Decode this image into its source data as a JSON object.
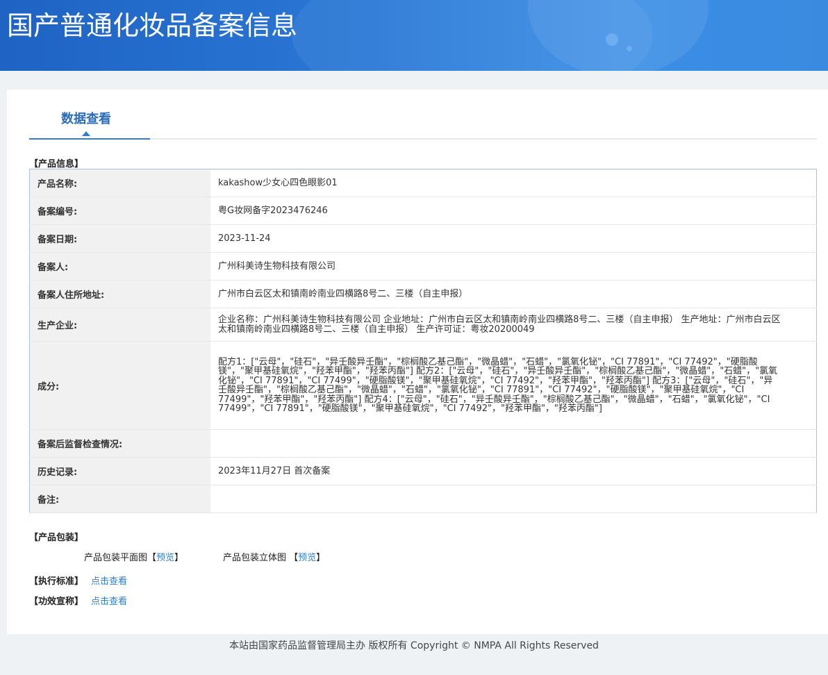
{
  "header": {
    "title": "国产普通化妆品备案信息"
  },
  "tabs": [
    {
      "label": "数据查看"
    }
  ],
  "product_info": {
    "section_title": "【产品信息】",
    "rows": [
      {
        "label": "产品名称:",
        "value": "kakashow少女心四色眼影01"
      },
      {
        "label": "备案编号:",
        "value": "粤G妆网备字2023476246"
      },
      {
        "label": "备案日期:",
        "value": "2023-11-24"
      },
      {
        "label": "备案人:",
        "value": "广州科美诗生物科技有限公司"
      },
      {
        "label": "备案人住所地址:",
        "value": "广州市白云区太和镇南岭南业四横路8号二、三楼（自主申报）"
      },
      {
        "label": "生产企业:",
        "value": "企业名称：广州科美诗生物科技有限公司 企业地址：广州市白云区太和镇南岭南业四横路8号二、三楼（自主申报） 生产地址：广州市白云区太和镇南岭南业四横路8号二、三楼（自主申报） 生产许可证：粤妆20200049"
      },
      {
        "label": "成分:",
        "value": "配方1：[\"云母\"，\"硅石\"，\"异壬酸异壬酯\"，\"棕榈酸乙基己酯\"，\"微晶蜡\"，\"石蜡\"，\"氯氧化铋\"，\"CI 77891\"，\"CI 77492\"，\"硬脂酸镁\"，\"聚甲基硅氧烷\"，\"羟苯甲酯\"，\"羟苯丙酯\"] 配方2：[\"云母\"，\"硅石\"，\"异壬酸异壬酯\"，\"棕榈酸乙基己酯\"，\"微晶蜡\"，\"石蜡\"，\"氯氧化铋\"，\"CI 77891\"，\"CI 77499\"，\"硬脂酸镁\"，\"聚甲基硅氧烷\"，\"CI 77492\"，\"羟苯甲酯\"，\"羟苯丙酯\"] 配方3：[\"云母\"，\"硅石\"，\"异壬酸异壬酯\"，\"棕榈酸乙基己酯\"，\"微晶蜡\"，\"石蜡\"，\"氯氧化铋\"，\"CI 77891\"，\"CI 77492\"，\"硬脂酸镁\"，\"聚甲基硅氧烷\"，\"CI 77499\"，\"羟苯甲酯\"，\"羟苯丙酯\"] 配方4：[\"云母\"，\"硅石\"，\"异壬酸异壬酯\"，\"棕榈酸乙基己酯\"，\"微晶蜡\"，\"石蜡\"，\"氯氧化铋\"，\"CI 77499\"，\"CI 77891\"，\"硬脂酸镁\"，\"聚甲基硅氧烷\"，\"CI 77492\"，\"羟苯甲酯\"，\"羟苯丙酯\"]"
      },
      {
        "label": "备案后监督检查情况:",
        "value": ""
      },
      {
        "label": "历史记录:",
        "value": "2023年11月27日 首次备案"
      },
      {
        "label": "备注:",
        "value": ""
      }
    ]
  },
  "packaging": {
    "section_title": "【产品包装】",
    "flat_label": "产品包装平面图",
    "three_d_label": "产品包装立体图",
    "preview_text": "预览"
  },
  "standard": {
    "section_title": "【执行标准】",
    "link": "点击查看"
  },
  "efficacy": {
    "section_title": "【功效宣称】",
    "link": "点击查看"
  },
  "footer": {
    "text": "本站由国家药品监督管理局主办 版权所有 Copyright © NMPA All Rights Reserved"
  }
}
